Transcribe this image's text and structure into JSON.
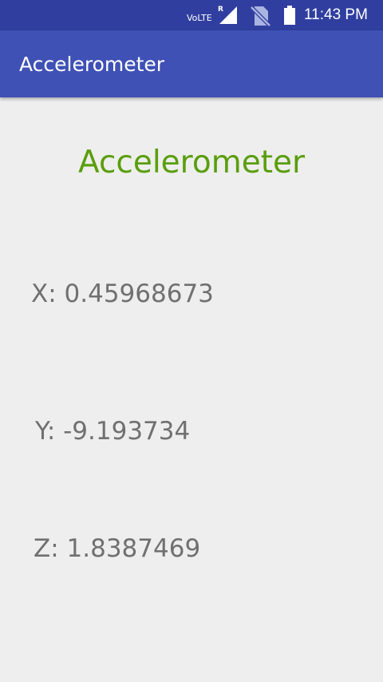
{
  "status_bar": {
    "network_label": "VoLTE",
    "roaming_indicator": "R",
    "time": "11:43 PM",
    "icons": [
      "signal-icon",
      "no-sim-icon",
      "battery-icon"
    ]
  },
  "app_bar": {
    "title": "Accelerometer",
    "color": "#3f51b5"
  },
  "main": {
    "heading": "Accelerometer",
    "heading_color": "#5a9e0a",
    "readings": {
      "x": "X: 0.45968673",
      "y": "Y: -9.193734",
      "z": "Z: 1.8387469"
    }
  }
}
